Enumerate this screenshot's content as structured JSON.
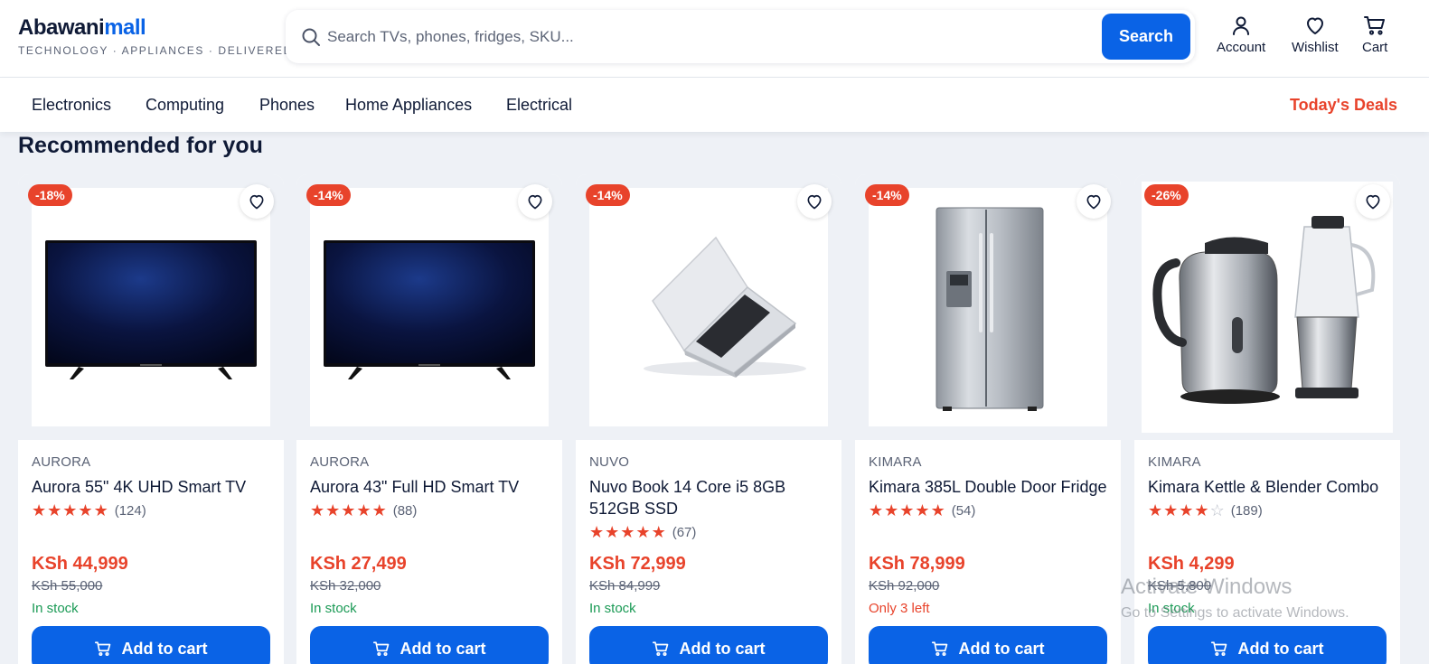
{
  "header": {
    "logo": {
      "part1": "Abawani",
      "part2": "mall"
    },
    "tagline": "TECHNOLOGY · APPLIANCES · DELIVERED",
    "search": {
      "placeholder": "Search TVs, phones, fridges, SKU...",
      "button": "Search"
    },
    "actions": {
      "account": "Account",
      "wishlist": "Wishlist",
      "cart": "Cart"
    }
  },
  "nav": {
    "items": [
      "Electronics",
      "Computing",
      "Phones",
      "Home Appliances",
      "Electrical"
    ],
    "deals": "Today's Deals"
  },
  "section_title": "Recommended for you",
  "products": [
    {
      "badge": "-18%",
      "brand": "AURORA",
      "name": "Aurora 55\" 4K UHD Smart TV",
      "stars": 5,
      "reviews": "(124)",
      "price": "KSh 44,999",
      "old_price": "KSh 55,000",
      "stock": "In stock",
      "image": "tv-icon",
      "button": "Add to cart"
    },
    {
      "badge": "-14%",
      "brand": "AURORA",
      "name": "Aurora 43\" Full HD Smart TV",
      "stars": 5,
      "reviews": "(88)",
      "price": "KSh 27,499",
      "old_price": "KSh 32,000",
      "stock": "In stock",
      "image": "tv-icon",
      "button": "Add to cart"
    },
    {
      "badge": "-14%",
      "brand": "NUVO",
      "name": "Nuvo Book 14 Core i5 8GB 512GB SSD",
      "stars": 5,
      "reviews": "(67)",
      "price": "KSh 72,999",
      "old_price": "KSh 84,999",
      "stock": "In stock",
      "image": "laptop-icon",
      "button": "Add to cart"
    },
    {
      "badge": "-14%",
      "brand": "KIMARA",
      "name": "Kimara 385L Double Door Fridge",
      "stars": 5,
      "reviews": "(54)",
      "price": "KSh 78,999",
      "old_price": "KSh 92,000",
      "stock": "Only 3 left",
      "image": "fridge-icon",
      "button": "Add to cart"
    },
    {
      "badge": "-26%",
      "brand": "KIMARA",
      "name": "Kimara Kettle & Blender Combo",
      "stars": 4,
      "reviews": "(189)",
      "price": "KSh 4,299",
      "old_price": "KSh 5,800",
      "stock": "In stock",
      "image": "kettle-blender-icon",
      "button": "Add to cart"
    }
  ],
  "watermark": {
    "line1": "Activate Windows",
    "line2": "Go to Settings to activate Windows."
  },
  "colors": {
    "accent": "#0a63e6",
    "sale": "#e8432b",
    "in_stock": "#1a9a55",
    "text": "#0f1a36",
    "background": "#eef1f6"
  }
}
